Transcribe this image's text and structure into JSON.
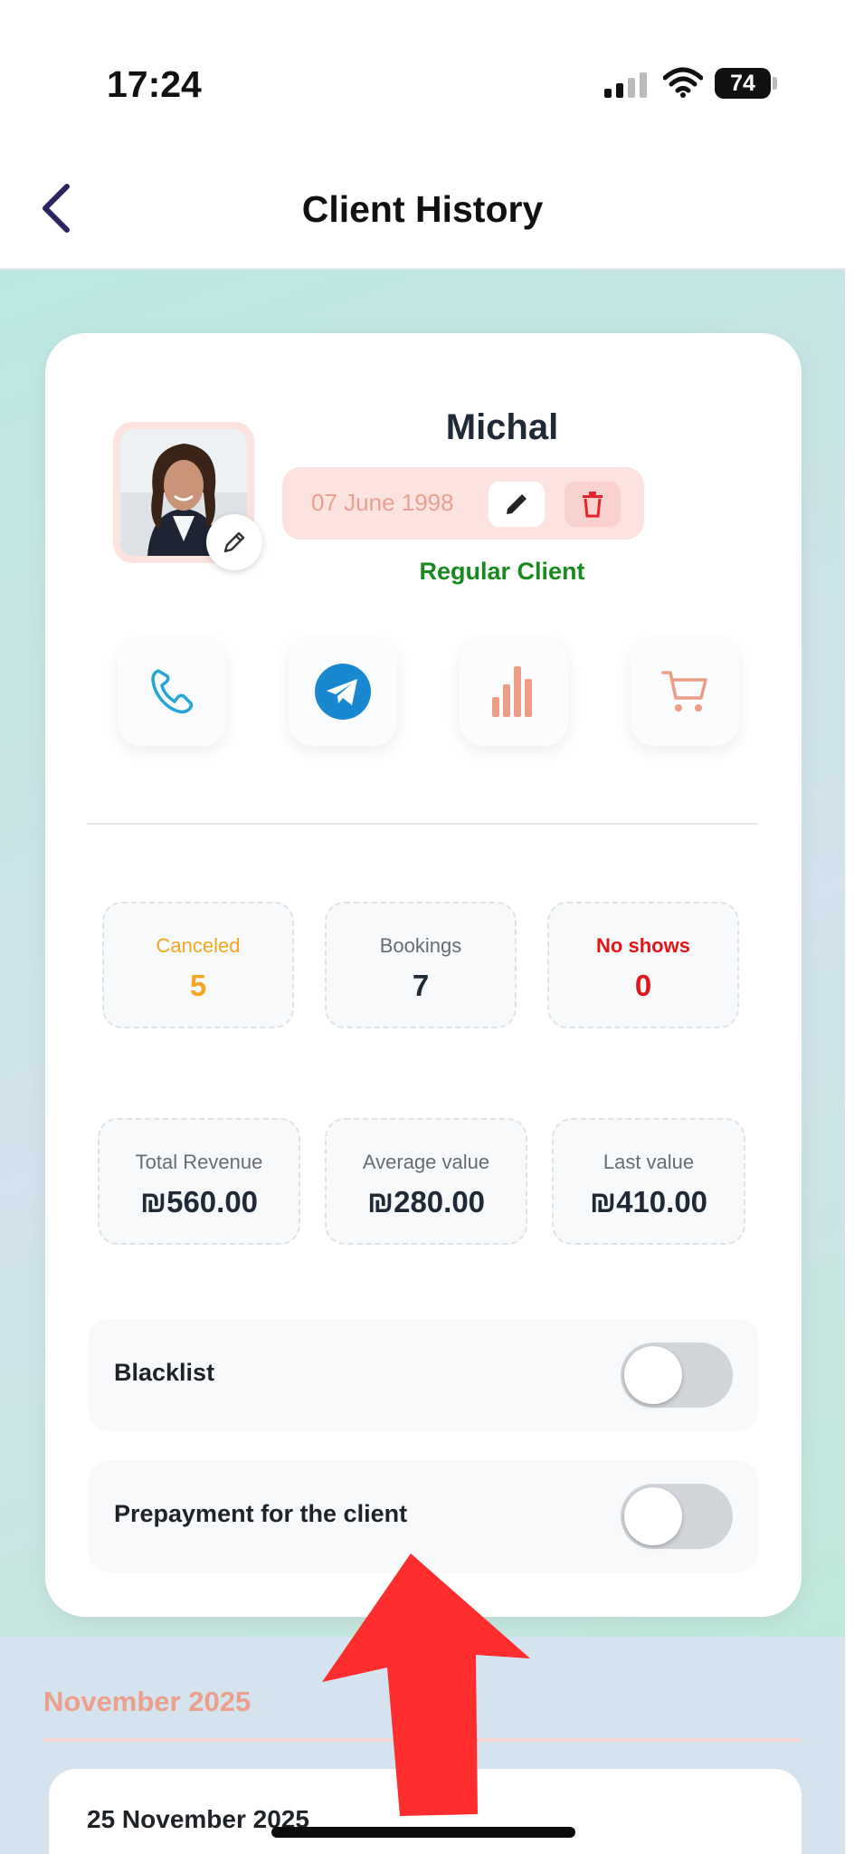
{
  "status_bar": {
    "time": "17:24",
    "battery": "74"
  },
  "nav": {
    "title": "Client History"
  },
  "client": {
    "name": "Michal",
    "dob": "07 June 1998",
    "status": "Regular Client"
  },
  "actions": [
    {
      "icon": "phone-icon"
    },
    {
      "icon": "telegram-icon"
    },
    {
      "icon": "bar-chart-icon"
    },
    {
      "icon": "cart-icon"
    }
  ],
  "stats_counts": [
    {
      "label": "Canceled",
      "value": "5",
      "color": "#f5a623"
    },
    {
      "label": "Bookings",
      "value": "7",
      "color": "#1f2a36"
    },
    {
      "label": "No shows",
      "value": "0",
      "color": "#e0161b"
    }
  ],
  "stats_money": [
    {
      "label": "Total Revenue",
      "value": "₪560.00"
    },
    {
      "label": "Average value",
      "value": "₪280.00"
    },
    {
      "label": "Last value",
      "value": "₪410.00"
    }
  ],
  "toggles": {
    "blacklist": {
      "label": "Blacklist",
      "on": false
    },
    "prepayment": {
      "label": "Prepayment for the client",
      "on": false
    }
  },
  "history": {
    "month": "November 2025",
    "first_booking_date": "25 November 2025"
  },
  "colors": {
    "accent": "#eca08c",
    "status_green": "#188a1e",
    "telegram": "#1a88d0",
    "danger": "#e0161b"
  }
}
